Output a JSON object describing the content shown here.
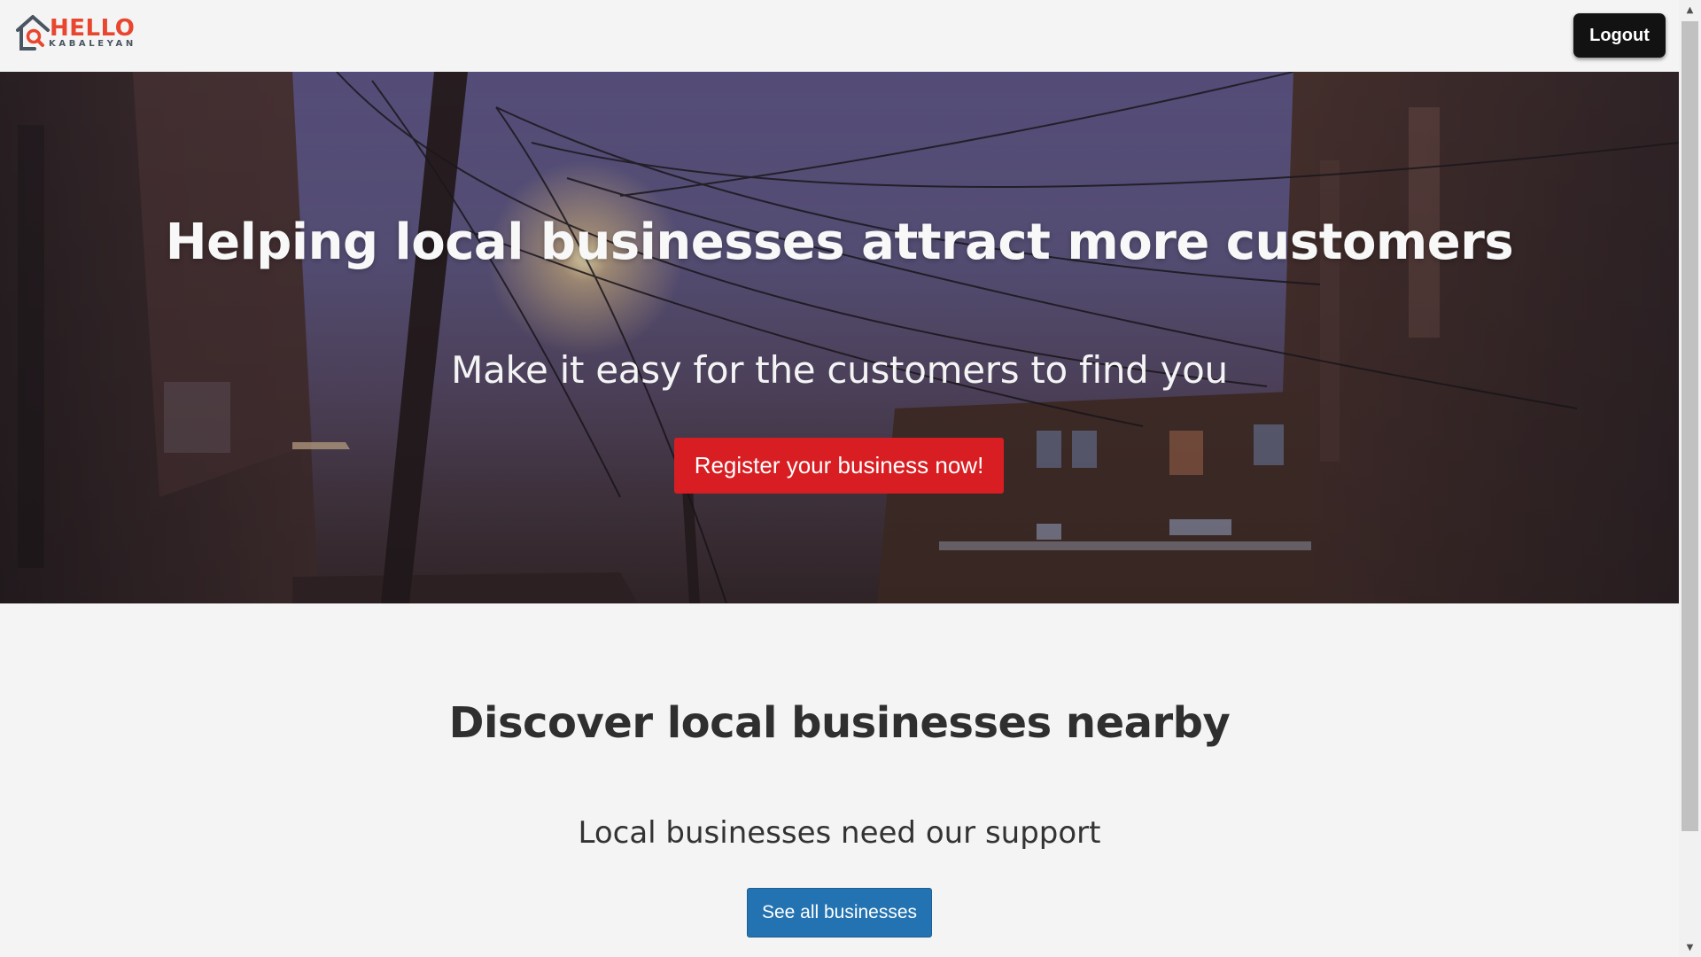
{
  "header": {
    "logo_main": "HELLO",
    "logo_sub": "KABALEYAN",
    "logout_label": "Logout"
  },
  "hero": {
    "title": "Helping local businesses attract more customers",
    "subtitle": "Make it easy for the customers to find you",
    "register_label": "Register your business now!"
  },
  "discover": {
    "title": "Discover local businesses nearby",
    "subtitle": "Local businesses need our support",
    "see_all_label": "See all businesses"
  },
  "scrollbar": {
    "up_icon": "triangle-up-icon",
    "down_icon": "triangle-down-icon"
  },
  "colors": {
    "brand_orange": "#e8462e",
    "logo_gray": "#4a5562",
    "register_red": "#d81e22",
    "see_all_blue": "#2373b2",
    "logout_black": "#121212"
  }
}
